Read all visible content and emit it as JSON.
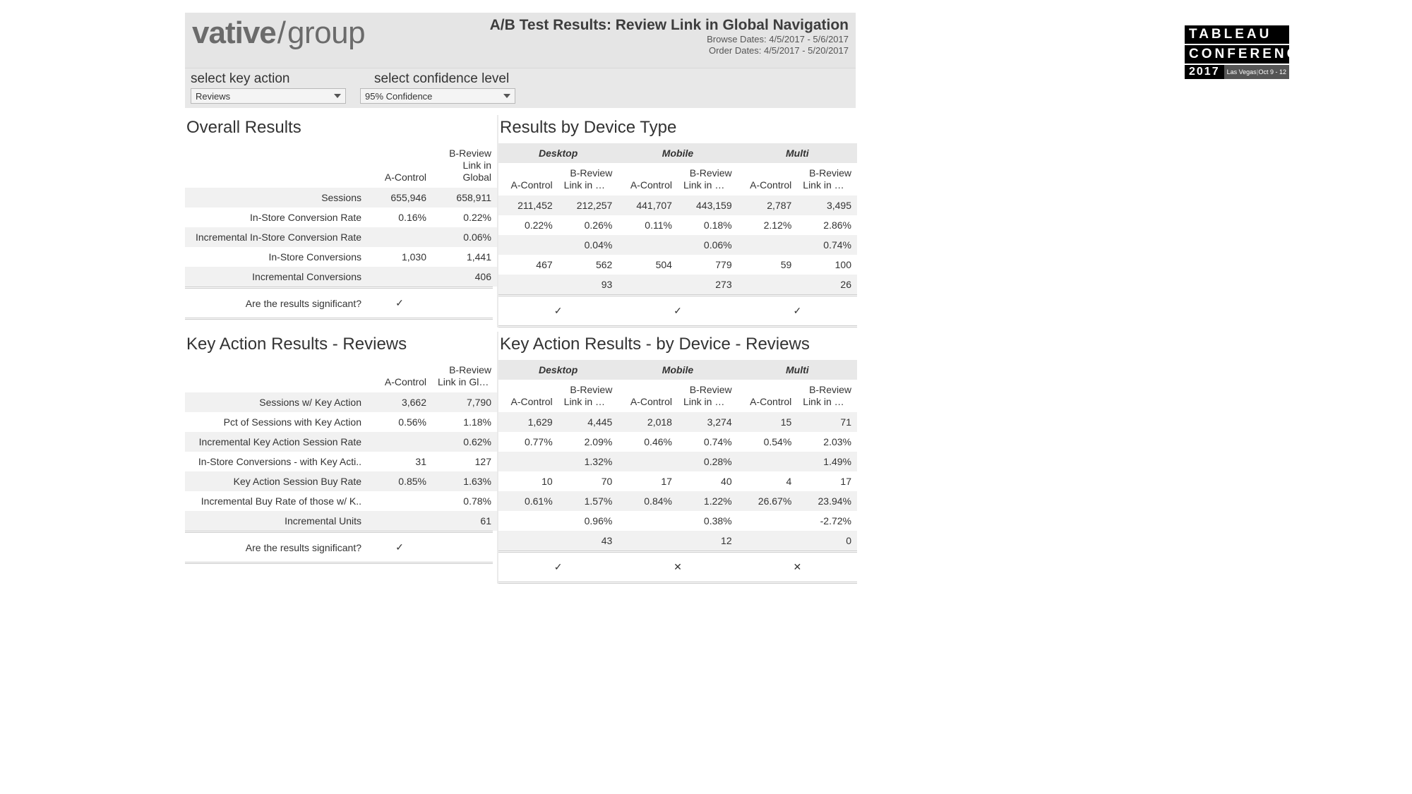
{
  "header": {
    "logo_text_main": "vative",
    "logo_text_group": "group",
    "title": "A/B Test Results:  Review Link in Global Navigation",
    "browse_dates": "Browse Dates: 4/5/2017 - 5/6/2017",
    "order_dates": "Order Dates: 4/5/2017 - 5/20/2017"
  },
  "filters": {
    "key_action_label": "select key action",
    "key_action_value": "Reviews",
    "confidence_label": "select confidence level",
    "confidence_value": "95% Confidence"
  },
  "sections": {
    "overall": "Overall Results",
    "by_device": "Results by Device Type",
    "key_action": "Key Action Results - Reviews",
    "key_action_device": "Key Action Results - by Device - Reviews"
  },
  "columns": {
    "a_control": "A-Control",
    "b_review_full": "B-Review Link in Global",
    "b_review_short": "B-Review Link in Glo..",
    "desktop": "Desktop",
    "mobile": "Mobile",
    "multi": "Multi"
  },
  "overall_rows": [
    {
      "label": "Sessions",
      "a": "655,946",
      "b": "658,911"
    },
    {
      "label": "In-Store Conversion Rate",
      "a": "0.16%",
      "b": "0.22%"
    },
    {
      "label": "Incremental In-Store Conversion Rate",
      "a": "",
      "b": "0.06%"
    },
    {
      "label": "In-Store Conversions",
      "a": "1,030",
      "b": "1,441"
    },
    {
      "label": "Incremental Conversions",
      "a": "",
      "b": "406"
    }
  ],
  "overall_sig": {
    "label": "Are the results significant?",
    "val": "✓"
  },
  "device_rows": [
    {
      "d_a": "211,452",
      "d_b": "212,257",
      "m_a": "441,707",
      "m_b": "443,159",
      "x_a": "2,787",
      "x_b": "3,495"
    },
    {
      "d_a": "0.22%",
      "d_b": "0.26%",
      "m_a": "0.11%",
      "m_b": "0.18%",
      "x_a": "2.12%",
      "x_b": "2.86%"
    },
    {
      "d_a": "",
      "d_b": "0.04%",
      "m_a": "",
      "m_b": "0.06%",
      "x_a": "",
      "x_b": "0.74%"
    },
    {
      "d_a": "467",
      "d_b": "562",
      "m_a": "504",
      "m_b": "779",
      "x_a": "59",
      "x_b": "100"
    },
    {
      "d_a": "",
      "d_b": "93",
      "m_a": "",
      "m_b": "273",
      "x_a": "",
      "x_b": "26"
    }
  ],
  "device_sig": {
    "d": "✓",
    "m": "✓",
    "x": "✓"
  },
  "ka_rows": [
    {
      "label": "Sessions w/ Key Action",
      "a": "3,662",
      "b": "7,790"
    },
    {
      "label": "Pct of Sessions with Key Action",
      "a": "0.56%",
      "b": "1.18%"
    },
    {
      "label": "Incremental Key Action Session Rate",
      "a": "",
      "b": "0.62%"
    },
    {
      "label": "In-Store Conversions - with Key Acti..",
      "a": "31",
      "b": "127"
    },
    {
      "label": "Key Action Session Buy Rate",
      "a": "0.85%",
      "b": "1.63%"
    },
    {
      "label": "Incremental Buy Rate of those w/ K..",
      "a": "",
      "b": "0.78%"
    },
    {
      "label": "Incremental Units",
      "a": "",
      "b": "61"
    }
  ],
  "ka_sig": {
    "label": "Are the results significant?",
    "val": "✓"
  },
  "ka_device_rows": [
    {
      "d_a": "1,629",
      "d_b": "4,445",
      "m_a": "2,018",
      "m_b": "3,274",
      "x_a": "15",
      "x_b": "71"
    },
    {
      "d_a": "0.77%",
      "d_b": "2.09%",
      "m_a": "0.46%",
      "m_b": "0.74%",
      "x_a": "0.54%",
      "x_b": "2.03%"
    },
    {
      "d_a": "",
      "d_b": "1.32%",
      "m_a": "",
      "m_b": "0.28%",
      "x_a": "",
      "x_b": "1.49%"
    },
    {
      "d_a": "10",
      "d_b": "70",
      "m_a": "17",
      "m_b": "40",
      "x_a": "4",
      "x_b": "17"
    },
    {
      "d_a": "0.61%",
      "d_b": "1.57%",
      "m_a": "0.84%",
      "m_b": "1.22%",
      "x_a": "26.67%",
      "x_b": "23.94%"
    },
    {
      "d_a": "",
      "d_b": "0.96%",
      "m_a": "",
      "m_b": "0.38%",
      "x_a": "",
      "x_b": "-2.72%"
    },
    {
      "d_a": "",
      "d_b": "43",
      "m_a": "",
      "m_b": "12",
      "x_a": "",
      "x_b": "0"
    }
  ],
  "ka_device_sig": {
    "d": "✓",
    "m": "✕",
    "x": "✕"
  },
  "badge": {
    "l1": "TABLEAU",
    "l2": "CONFERENCE",
    "year": "2017",
    "loc": "Las Vegas",
    "dates": "Oct 9 - 12"
  }
}
